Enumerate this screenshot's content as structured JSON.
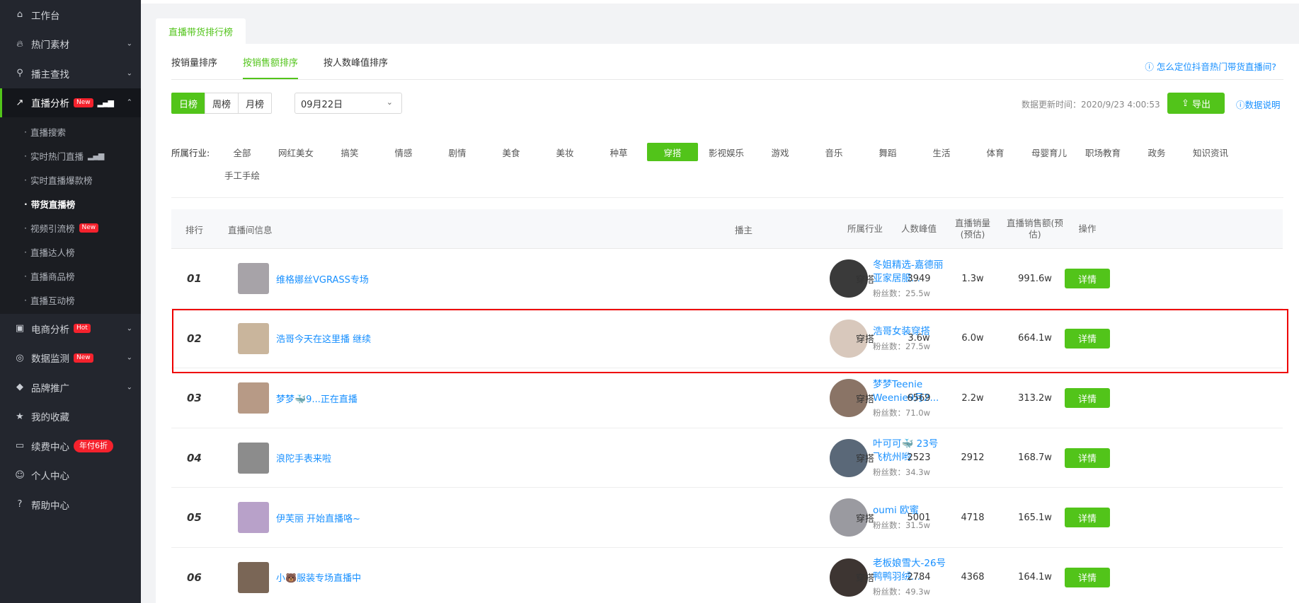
{
  "sidebar": {
    "items": [
      {
        "label": "工作台",
        "icon": "home-icon"
      },
      {
        "label": "热门素材",
        "icon": "fire-icon",
        "chevron": true
      },
      {
        "label": "播主查找",
        "icon": "search-icon",
        "chevron": true
      },
      {
        "label": "直播分析",
        "icon": "trend-icon",
        "badge": "New",
        "active": true
      },
      {
        "label": "电商分析",
        "icon": "bag-icon",
        "badge": "Hot",
        "chevron": true
      },
      {
        "label": "数据监测",
        "icon": "monitor-icon",
        "badge": "New",
        "chevron": true
      },
      {
        "label": "品牌推广",
        "icon": "diamond-icon",
        "chevron": true
      },
      {
        "label": "我的收藏",
        "icon": "star-icon"
      },
      {
        "label": "续费中心",
        "icon": "card-icon",
        "badge": "年付6折"
      },
      {
        "label": "个人中心",
        "icon": "user-icon"
      },
      {
        "label": "帮助中心",
        "icon": "help-icon"
      }
    ],
    "live_sub": [
      "直播搜索",
      "实时热门直播",
      "实时直播爆款榜",
      "带货直播榜",
      "视频引流榜",
      "直播达人榜",
      "直播商品榜",
      "直播互动榜"
    ],
    "live_sub_new_badge": "New"
  },
  "header": {
    "tab": "直播带货排行榜"
  },
  "subtabs": [
    "按销量排序",
    "按销售额排序",
    "按人数峰值排序"
  ],
  "help_link": "怎么定位抖音热门带货直播间?",
  "period": [
    "日榜",
    "周榜",
    "月榜"
  ],
  "date": "09月22日",
  "update_time": "数据更新时间：2020/9/23 4:00:53",
  "export_label": "导出",
  "data_explain": "数据说明",
  "industry_label": "所属行业:",
  "industries": [
    "全部",
    "网红美女",
    "搞笑",
    "情感",
    "剧情",
    "美食",
    "美妆",
    "种草",
    "穿搭",
    "影视娱乐",
    "游戏",
    "音乐",
    "舞蹈",
    "生活",
    "体育",
    "母婴育儿",
    "职场教育",
    "政务",
    "知识资讯",
    "手工手绘"
  ],
  "selected_industry": "穿搭",
  "table": {
    "headers": {
      "rank": "排行",
      "room": "直播间信息",
      "host": "播主",
      "industry": "所属行业",
      "peak": "人数峰值",
      "sales_volume": "直播销量(预估)",
      "sales_amount": "直播销售额(预估)",
      "action": "操作"
    },
    "rows": [
      {
        "rank": "01",
        "title": "维格娜丝VGRASS专场",
        "host": "冬姐精选-嘉德丽亚家居服...",
        "fans": "粉丝数：25.5w",
        "industry": "穿搭",
        "peak": "3949",
        "volume": "1.3w",
        "amount": "991.6w",
        "btn": "详情"
      },
      {
        "rank": "02",
        "title": "浩哥今天在这里播 继续",
        "host": "浩哥女装穿搭",
        "fans": "粉丝数：27.5w",
        "industry": "穿搭",
        "peak": "3.6w",
        "volume": "6.0w",
        "amount": "664.1w",
        "btn": "详情"
      },
      {
        "rank": "03",
        "title": "梦梦🐳9...正在直播",
        "host": "梦梦Teenie Weenie9月2...",
        "fans": "粉丝数：71.0w",
        "industry": "穿搭",
        "peak": "6569",
        "volume": "2.2w",
        "amount": "313.2w",
        "btn": "详情"
      },
      {
        "rank": "04",
        "title": "浪陀手表来啦",
        "host": "叶可可🐳 23号飞杭州哟",
        "fans": "粉丝数：34.3w",
        "industry": "穿搭",
        "peak": "2523",
        "volume": "2912",
        "amount": "168.7w",
        "btn": "详情"
      },
      {
        "rank": "05",
        "title": "伊芙丽 开始直播咯~",
        "host": "oumi 欧蜜",
        "fans": "粉丝数：31.5w",
        "industry": "穿搭",
        "peak": "5001",
        "volume": "4718",
        "amount": "165.1w",
        "btn": "详情"
      },
      {
        "rank": "06",
        "title": "小🐻服装专场直播中",
        "host": "老板娘雪大-26号鸭鸭羽绒...",
        "fans": "粉丝数：49.3w",
        "industry": "穿搭",
        "peak": "2784",
        "volume": "4368",
        "amount": "164.1w",
        "btn": "详情"
      }
    ]
  },
  "colors": {
    "accent": "#52c41a",
    "link": "#1890ff",
    "sidebar": "#23262e",
    "badge": "#f5222d",
    "highlight": "#e00000"
  }
}
